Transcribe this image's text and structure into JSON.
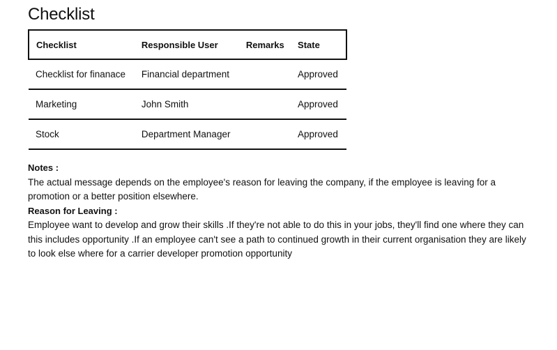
{
  "title": "Checklist",
  "table": {
    "headers": [
      "Checklist",
      "Responsible User",
      "Remarks",
      "State"
    ],
    "rows": [
      {
        "checklist": "Checklist for finanace",
        "user": "Financial department",
        "remarks": "",
        "state": "Approved"
      },
      {
        "checklist": "Marketing",
        "user": "John Smith",
        "remarks": "",
        "state": "Approved"
      },
      {
        "checklist": "Stock",
        "user": "Department Manager",
        "remarks": "",
        "state": "Approved"
      }
    ]
  },
  "notes": {
    "label": "Notes :",
    "text": "The actual message depends on the employee's reason for leaving the company, if the employee is leaving for a promotion or a better position elsewhere."
  },
  "reason": {
    "label": "Reason for Leaving :",
    "text": "Employee want to develop and grow their skills .If they're not able to do this in your jobs, they'll find one where they can this includes opportunity .If an employee can't see a path to continued growth in their current organisation they are likely to look else where for a carrier developer promotion opportunity"
  }
}
